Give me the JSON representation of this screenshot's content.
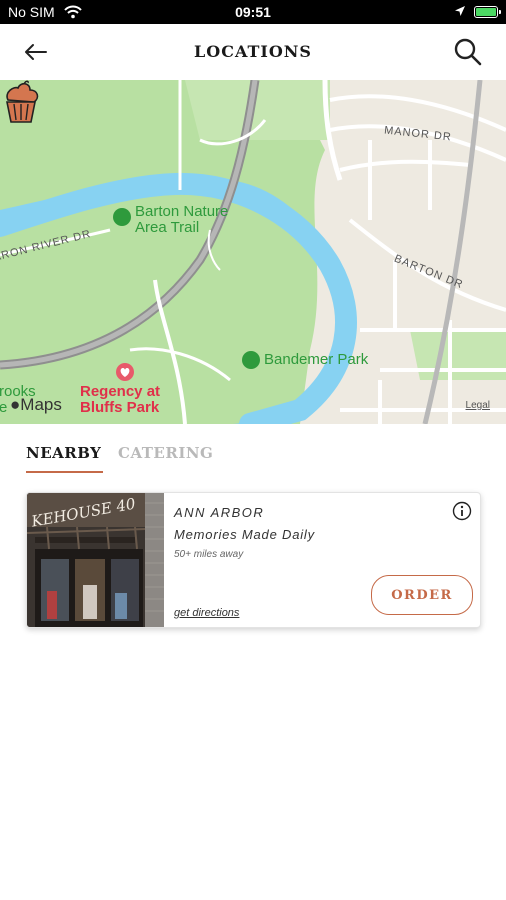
{
  "status_bar": {
    "carrier": "No SIM",
    "time": "09:51",
    "icons": [
      "wifi-icon",
      "location-arrow-icon",
      "battery-charging-icon"
    ],
    "battery_color": "#4cd964"
  },
  "header": {
    "title": "LOCATIONS",
    "back_icon": "arrow-left-icon",
    "search_icon": "search-icon"
  },
  "map": {
    "parks": [
      {
        "name": "Barton Nature Area Trail"
      },
      {
        "name": "Bandemer Park"
      }
    ],
    "streets": [
      "MANOR DR",
      "BARTON DR",
      "ARON RIVER DR"
    ],
    "poi": {
      "name": "Regency at Bluffs Park",
      "icon": "heart-pin-icon"
    },
    "partial_label": "rrooks re",
    "attribution": "Maps",
    "legal": "Legal",
    "marker_icon": "cupcake-icon",
    "colors": {
      "water": "#87d2f2",
      "park": "#b8e0a2",
      "land": "#eeeae1",
      "road_major": "#9c9c9c",
      "park_label": "#2e9a3c",
      "poi_label": "#e0304a"
    }
  },
  "tabs": [
    {
      "label": "NEARBY",
      "active": true
    },
    {
      "label": "CATERING",
      "active": false
    }
  ],
  "location_card": {
    "photo_sign": "KEHOUSE 40",
    "city": "ANN ARBOR",
    "tagline": "Memories Made Daily",
    "distance": "50+ miles away",
    "directions_label": "get directions",
    "order_label": "ORDER",
    "info_icon": "info-icon"
  },
  "accent_color": "#c56a48"
}
